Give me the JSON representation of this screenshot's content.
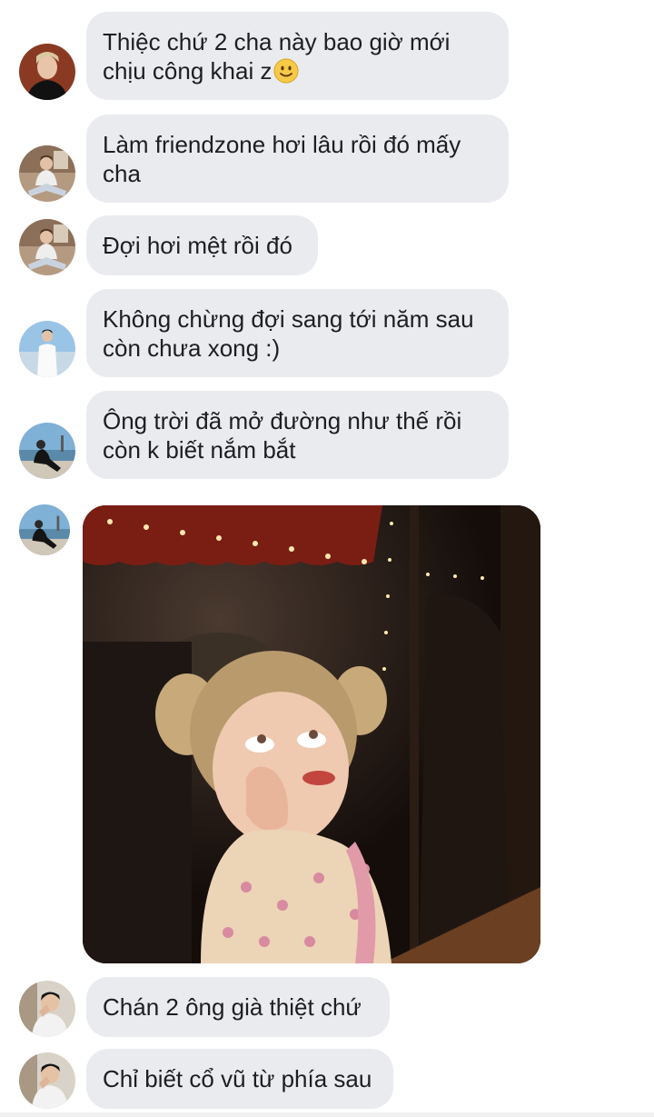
{
  "messages": [
    {
      "avatar": "avatar-dark-hoodie",
      "line1": "Thiệc chứ 2 cha này bao giờ mới",
      "line2": "chịu công khai z",
      "emoji": "slightly-smiling-face-icon"
    },
    {
      "avatar": "avatar-sitting-white",
      "line1": "Làm friendzone hơi lâu rồi đó mấy",
      "line2": "cha"
    },
    {
      "avatar": "avatar-sitting-white",
      "line1": "Đợi hơi mệt rồi đó"
    },
    {
      "avatar": "avatar-white-shirt-beach",
      "line1": "Không chừng đợi sang tới năm sau",
      "line2": "còn chưa xong :)"
    },
    {
      "avatar": "avatar-seaside-black",
      "line1": "Ông trời đã mở đường như thế rồi",
      "line2": "còn k biết nắm bắt"
    },
    {
      "avatar": "avatar-seaside-black",
      "image": "photo-girl-rolling-eyes"
    },
    {
      "avatar": "avatar-boy-hands-face",
      "line1": "Chán 2 ông già thiệt chứ"
    },
    {
      "avatar": "avatar-boy-hands-face",
      "line1": "Chỉ biết cổ vũ từ phía sau"
    }
  ],
  "colors": {
    "bubble": "#e9ebee",
    "text": "#1c1e21",
    "background": "#ffffff"
  }
}
